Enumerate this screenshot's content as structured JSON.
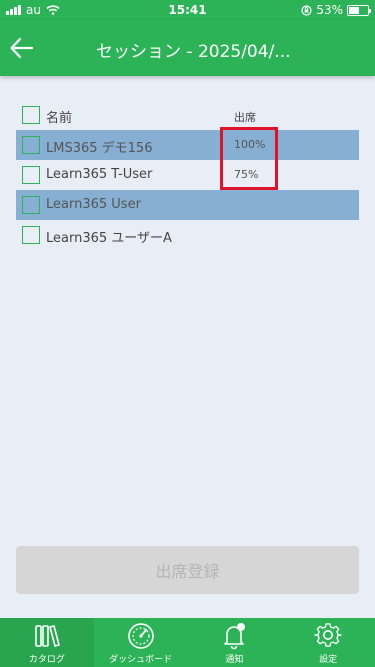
{
  "status_bar": {
    "carrier": "au",
    "time": "15:41",
    "battery": "53%",
    "battery_level": 0.53
  },
  "header": {
    "title": "セッション - 2025/04/..."
  },
  "list": {
    "col_name": "名前",
    "col_attendance": "出席",
    "rows": [
      {
        "name": "LMS365 デモ156",
        "attendance": "100%",
        "selected": true
      },
      {
        "name": "Learn365 T-User",
        "attendance": "75%",
        "selected": false
      },
      {
        "name": "Learn365 User",
        "attendance": "",
        "selected": true
      },
      {
        "name": "Learn365 ユーザーA",
        "attendance": "",
        "selected": false
      }
    ]
  },
  "submit_label": "出席登録",
  "tabs": [
    {
      "label": "カタログ",
      "icon": "books-icon"
    },
    {
      "label": "ダッシュボード",
      "icon": "gauge-icon"
    },
    {
      "label": "通知",
      "icon": "bell-icon"
    },
    {
      "label": "設定",
      "icon": "gear-icon"
    }
  ],
  "colors": {
    "primary": "#2db357",
    "selected_row": "#87aed3",
    "highlight": "#e0132a"
  }
}
